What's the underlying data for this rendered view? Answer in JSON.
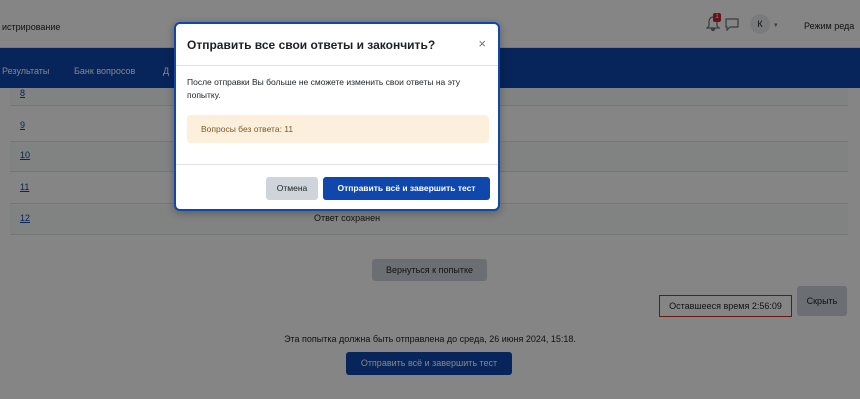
{
  "header": {
    "course_title": "истрирование",
    "notification_count": "1",
    "user_initial": "К",
    "edit_mode_label": "Режим реда"
  },
  "nav": {
    "items": [
      "Результаты",
      "Банк вопросов",
      "Д"
    ]
  },
  "table": {
    "rows": [
      {
        "num": "8",
        "status": ""
      },
      {
        "num": "9",
        "status": ""
      },
      {
        "num": "10",
        "status": ""
      },
      {
        "num": "11",
        "status": ""
      },
      {
        "num": "12",
        "status": "Ответ сохранен"
      }
    ]
  },
  "actions": {
    "return_label": "Вернуться к попытке",
    "timer_text": "Оставшееся время 2:56:09",
    "hide_label": "Скрыть",
    "deadline_text": "Эта попытка должна быть отправлена до среда, 26 июня 2024, 15:18.",
    "submit_label": "Отправить всё и завершить тест"
  },
  "modal": {
    "title": "Отправить все свои ответы и закончить?",
    "close_symbol": "×",
    "body_text": "После отправки Вы больше не сможете изменить свои ответы на эту попытку.",
    "alert_text": "Вопросы без ответа: 11",
    "cancel_label": "Отмена",
    "confirm_label": "Отправить всё и завершить тест"
  },
  "colors": {
    "primary": "#0f47ad",
    "alert_bg": "#fcefdc",
    "timer_border": "#ca3120"
  }
}
